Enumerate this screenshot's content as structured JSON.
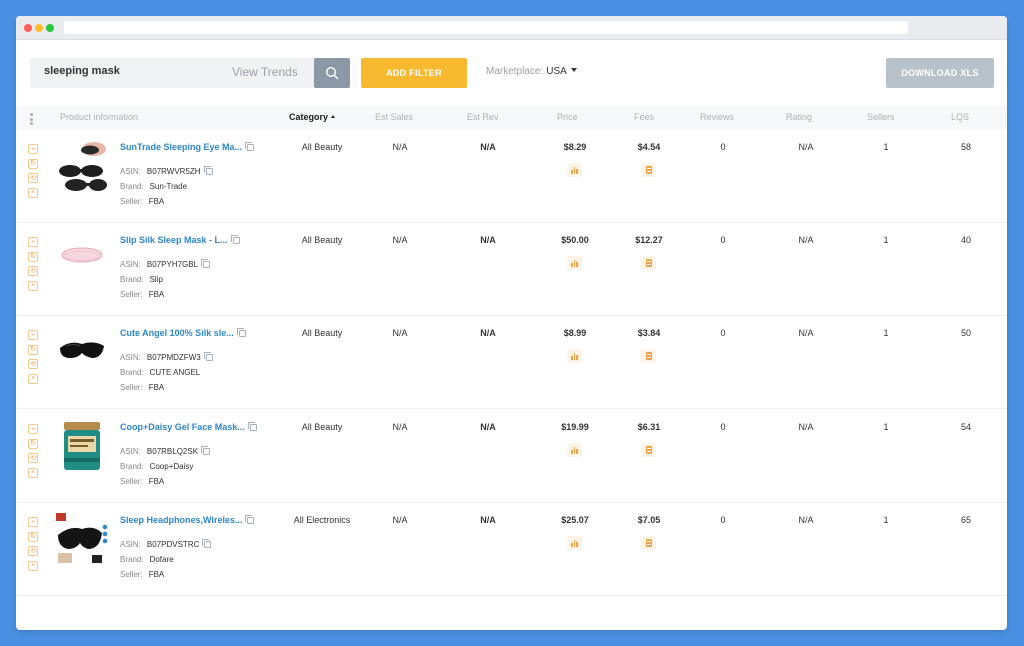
{
  "search": {
    "value": "sleeping mask",
    "view_trends_label": "View Trends"
  },
  "toolbar": {
    "add_filter_label": "ADD FILTER",
    "marketplace_label": "Marketplace:",
    "marketplace_value": "USA",
    "download_label": "DOWNLOAD XLS"
  },
  "colors": {
    "accent": "#f7b92f",
    "link": "#2f86c9",
    "background": "#4a90e2"
  },
  "columns": {
    "product": "Product information",
    "category": "Category",
    "est_sales": "Est Sales",
    "est_rev": "Est Rev",
    "price": "Price",
    "fees": "Fees",
    "reviews": "Reviews",
    "rating": "Rating",
    "sellers": "Sellers",
    "lqs": "LQS"
  },
  "labels": {
    "asin": "ASIN:",
    "brand": "Brand:",
    "seller": "Seller:"
  },
  "rows": [
    {
      "title": "SunTrade Sleeping Eye Ma...",
      "asin": "B07RWVR5ZH",
      "brand": "Sun-Trade",
      "seller": "FBA",
      "category": "All Beauty",
      "est_sales": "N/A",
      "est_rev": "N/A",
      "price": "$8.29",
      "fees": "$4.54",
      "reviews": "0",
      "rating": "N/A",
      "sellers": "1",
      "lqs": "58"
    },
    {
      "title": "Slip Silk Sleep Mask - L...",
      "asin": "B07PYH7GBL",
      "brand": "Slip",
      "seller": "FBA",
      "category": "All Beauty",
      "est_sales": "N/A",
      "est_rev": "N/A",
      "price": "$50.00",
      "fees": "$12.27",
      "reviews": "0",
      "rating": "N/A",
      "sellers": "1",
      "lqs": "40"
    },
    {
      "title": "Cute Angel 100% Silk sle...",
      "asin": "B07PMDZFW3",
      "brand": "CUTE ANGEL",
      "seller": "FBA",
      "category": "All Beauty",
      "est_sales": "N/A",
      "est_rev": "N/A",
      "price": "$8.99",
      "fees": "$3.84",
      "reviews": "0",
      "rating": "N/A",
      "sellers": "1",
      "lqs": "50"
    },
    {
      "title": "Coop+Daisy Gel Face Mask...",
      "asin": "B07RBLQ2SK",
      "brand": "Coop+Daisy",
      "seller": "FBA",
      "category": "All Beauty",
      "est_sales": "N/A",
      "est_rev": "N/A",
      "price": "$19.99",
      "fees": "$6.31",
      "reviews": "0",
      "rating": "N/A",
      "sellers": "1",
      "lqs": "54"
    },
    {
      "title": "Sleep Headphones,Wireles...",
      "asin": "B07PDVSTRC",
      "brand": "Dofare",
      "seller": "FBA",
      "category": "All Electronics",
      "est_sales": "N/A",
      "est_rev": "N/A",
      "price": "$25.07",
      "fees": "$7.05",
      "reviews": "0",
      "rating": "N/A",
      "sellers": "1",
      "lqs": "65"
    }
  ]
}
